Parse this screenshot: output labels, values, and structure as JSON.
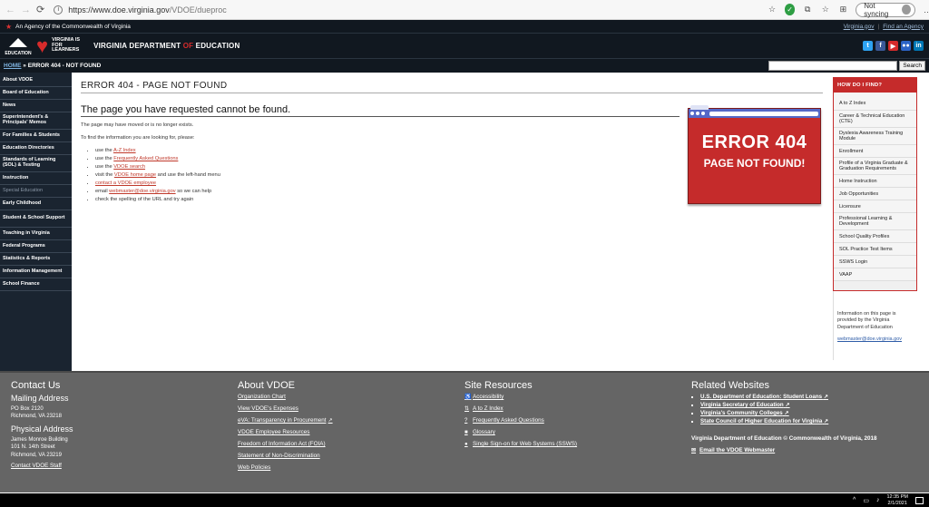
{
  "browser": {
    "url_host": "https://www.doe.virginia.gov",
    "url_path": "/VDOE/dueproc",
    "sync_label": "Not syncing"
  },
  "agency": {
    "text": "An Agency of the Commonwealth of Virginia",
    "link1": "Virginia.gov",
    "link2": "Find an Agency"
  },
  "header": {
    "logo_edu": "EDUCATION",
    "logo_vfl": "VIRGINIA IS FOR LEARNERS",
    "dept_a": "VIRGINIA DEPARTMENT ",
    "dept_of": "OF",
    "dept_b": " EDUCATION",
    "social": [
      "t",
      "f",
      "▶",
      "●●",
      "in"
    ]
  },
  "breadcrumb": {
    "home": "HOME",
    "sep": " » ",
    "current": "ERROR 404 - NOT FOUND",
    "search_button": "Search"
  },
  "sidebar": [
    "About VDOE",
    "Board of Education",
    "News",
    "Superintendent's & Principals' Memos",
    "For Families & Students",
    "Education Directories",
    "Standards of Learning (SOL) & Testing",
    "Instruction",
    "Special Education",
    "Early Childhood",
    "Student & School Support",
    "Teaching in Virginia",
    "Federal Programs",
    "Statistics & Reports",
    "Information Management",
    "School Finance"
  ],
  "main": {
    "title": "ERROR 404 - PAGE NOT FOUND",
    "heading": "The page you have requested cannot be found.",
    "p1": "The page may have moved or is no longer exists.",
    "p2": "To find the information you are looking for, please:",
    "li1_pre": "use the ",
    "li1_link": "A-Z Index",
    "li2_pre": "use the ",
    "li2_link": "Frequently Asked Questions",
    "li3_pre": "use the ",
    "li3_link": "VDOE search",
    "li4_pre": "visit the ",
    "li4_link": "VDOE home page",
    "li4_post": " and use the left-hand menu",
    "li5_link": "contact a VDOE employee",
    "li6_pre": "email ",
    "li6_link": "webmaster@doe.virginia.gov",
    "li6_post": " so we can help",
    "li7": "check the spelling of the URL and try again",
    "error_image_line1": "ERROR 404",
    "error_image_line2": "PAGE NOT FOUND!"
  },
  "howdoi": {
    "title": "HOW DO I FIND?",
    "items": [
      "A to Z Index",
      "Career & Technical Education (CTE)",
      "Dyslexia Awareness Training Module",
      "Enrollment",
      "Profile of a Virginia Graduate & Graduation Requirements",
      "Home Instruction",
      "Job Opportunities",
      "Licensure",
      "Professional Learning & Development",
      "School Quality Profiles",
      "SOL Practice Test Items",
      "SSWS Login",
      "VAAP"
    ],
    "note": "Information on this page is provided by the Virginia Department of Education",
    "email": "webmaster@doe.virginia.gov"
  },
  "footer": {
    "contact": {
      "title": "Contact Us",
      "mail_title": "Mailing Address",
      "mail_1": "PO Box 2120",
      "mail_2": "Richmond, VA 23218",
      "phys_title": "Physical Address",
      "phys_1": "James Monroe Building",
      "phys_2": "101 N. 14th Street",
      "phys_3": "Richmond, VA 23219",
      "staff": "Contact VDOE Staff"
    },
    "about": {
      "title": "About VDOE",
      "links": [
        "Organization Chart",
        "View VDOE's Expenses",
        "eVA: Transparency in Procurement",
        "VDOE Employee Resources",
        "Freedom of Information Act (FOIA)",
        "Statement of Non-Discrimination",
        "Web Policies"
      ]
    },
    "resources": {
      "title": "Site Resources",
      "links": [
        "Accessibility",
        "A to Z Index",
        "Frequently Asked Questions",
        "Glossary",
        "Single Sign-on for Web Systems (SSWS)"
      ]
    },
    "related": {
      "title": "Related Websites",
      "links": [
        "U.S. Department of Education: Student Loans",
        "Virginia Secretary of Education",
        "Virginia's Community Colleges",
        "State Council of Higher Education for Virginia"
      ],
      "copyright": "Virginia Department of Education © Commonwealth of Virginia, 2018",
      "webmaster": "Email the VDOE Webmaster"
    }
  },
  "taskbar": {
    "time": "12:35 PM",
    "date": "2/1/2021"
  }
}
